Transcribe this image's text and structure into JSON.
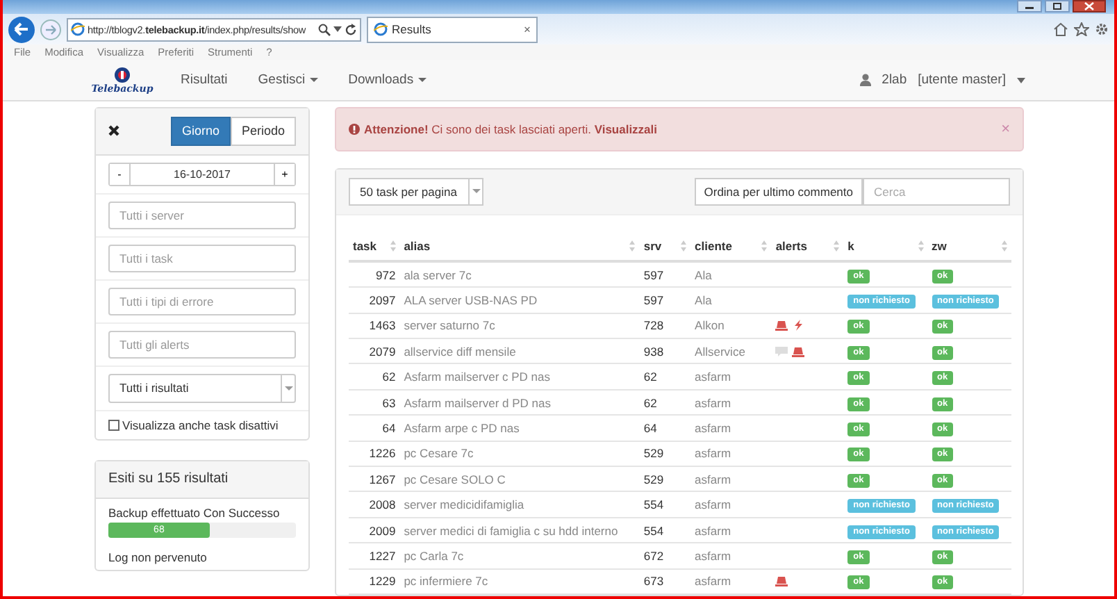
{
  "browser": {
    "address": "http://tblogv2.**telebackup.it**/index.php/results/show",
    "tab": {
      "title": "Results",
      "close": "×"
    },
    "menu": [
      "File",
      "Modifica",
      "Visualizza",
      "Preferiti",
      "Strumenti",
      "?"
    ]
  },
  "navbar": {
    "brand": "Telebackup",
    "links": [
      {
        "label": "Risultati",
        "dropdown": false
      },
      {
        "label": "Gestisci",
        "dropdown": true
      },
      {
        "label": "Downloads",
        "dropdown": true
      }
    ],
    "user": "2lab",
    "role": "[utente master]"
  },
  "filters": {
    "modes": [
      {
        "label": "Giorno",
        "selected": true
      },
      {
        "label": "Periodo",
        "selected": false
      }
    ],
    "date": {
      "minus": "-",
      "value": "16-10-2017",
      "plus": "+"
    },
    "fields": [
      {
        "placeholder": "Tutti i server"
      },
      {
        "placeholder": "Tutti i task"
      },
      {
        "placeholder": "Tutti i tipi di errore"
      },
      {
        "placeholder": "Tutti gli alerts"
      }
    ],
    "result_select": "Tutti i risultati",
    "show_disabled": {
      "label": "Visualizza anche task disattivi",
      "checked": false
    }
  },
  "summary": {
    "title": "Esiti su 155 risultati",
    "items": [
      {
        "label": "Backup effettuato Con Successo",
        "count": "68",
        "level": 0.54
      },
      {
        "label": "Log non pervenuto"
      }
    ]
  },
  "alert": {
    "text": "**Attenzione!** Ci sono dei task lasciati aperti. **Visualizzali**",
    "close": "×"
  },
  "toolbar": {
    "page_size": "50 task per pagina",
    "sort_button": "Ordina per ultimo commento",
    "search_placeholder": "Cerca"
  },
  "table": {
    "columns": [
      "task",
      "alias",
      "srv",
      "cliente",
      "alerts",
      "k",
      "zw"
    ],
    "rows": [
      {
        "task": "972",
        "alias": "ala server 7c",
        "srv": "597",
        "cliente": "Ala",
        "alerts": [],
        "k": {
          "label": "ok",
          "kind": "success"
        },
        "zw": {
          "label": "ok",
          "kind": "success"
        }
      },
      {
        "task": "2097",
        "alias": "ALA server USB-NAS PD",
        "srv": "597",
        "cliente": "Ala",
        "alerts": [],
        "k": {
          "label": "non richiesto",
          "kind": "info"
        },
        "zw": {
          "label": "non richiesto",
          "kind": "info"
        }
      },
      {
        "task": "1463",
        "alias": "server saturno 7c",
        "srv": "728",
        "cliente": "Alkon",
        "alerts": [
          {
            "kind": "siren"
          },
          {
            "kind": "bolt"
          }
        ],
        "k": {
          "label": "ok",
          "kind": "success"
        },
        "zw": {
          "label": "ok",
          "kind": "success"
        }
      },
      {
        "task": "2079",
        "alias": "allservice diff mensile",
        "srv": "938",
        "cliente": "Allservice",
        "alerts": [
          {
            "kind": "comment"
          },
          {
            "kind": "siren"
          }
        ],
        "k": {
          "label": "ok",
          "kind": "success"
        },
        "zw": {
          "label": "ok",
          "kind": "success"
        }
      },
      {
        "task": "62",
        "alias": "Asfarm mailserver c PD nas",
        "srv": "62",
        "cliente": "asfarm",
        "alerts": [],
        "k": {
          "label": "ok",
          "kind": "success"
        },
        "zw": {
          "label": "ok",
          "kind": "success"
        }
      },
      {
        "task": "63",
        "alias": "Asfarm mailserver d PD nas",
        "srv": "62",
        "cliente": "asfarm",
        "alerts": [],
        "k": {
          "label": "ok",
          "kind": "success"
        },
        "zw": {
          "label": "ok",
          "kind": "success"
        }
      },
      {
        "task": "64",
        "alias": "Asfarm arpe c PD nas",
        "srv": "64",
        "cliente": "asfarm",
        "alerts": [],
        "k": {
          "label": "ok",
          "kind": "success"
        },
        "zw": {
          "label": "ok",
          "kind": "success"
        }
      },
      {
        "task": "1226",
        "alias": "pc Cesare 7c",
        "srv": "529",
        "cliente": "asfarm",
        "alerts": [],
        "k": {
          "label": "ok",
          "kind": "success"
        },
        "zw": {
          "label": "ok",
          "kind": "success"
        }
      },
      {
        "task": "1267",
        "alias": "pc Cesare SOLO C",
        "srv": "529",
        "cliente": "asfarm",
        "alerts": [],
        "k": {
          "label": "ok",
          "kind": "success"
        },
        "zw": {
          "label": "ok",
          "kind": "success"
        }
      },
      {
        "task": "2008",
        "alias": "server medicidifamiglia",
        "srv": "554",
        "cliente": "asfarm",
        "alerts": [],
        "k": {
          "label": "non richiesto",
          "kind": "info"
        },
        "zw": {
          "label": "non richiesto",
          "kind": "info"
        }
      },
      {
        "task": "2009",
        "alias": "server medici di famiglia c su hdd interno",
        "srv": "554",
        "cliente": "asfarm",
        "alerts": [],
        "k": {
          "label": "non richiesto",
          "kind": "info"
        },
        "zw": {
          "label": "non richiesto",
          "kind": "info"
        }
      },
      {
        "task": "1227",
        "alias": "pc Carla 7c",
        "srv": "672",
        "cliente": "asfarm",
        "alerts": [],
        "k": {
          "label": "ok",
          "kind": "success"
        },
        "zw": {
          "label": "ok",
          "kind": "success"
        }
      },
      {
        "task": "1229",
        "alias": "pc infermiere 7c",
        "srv": "673",
        "cliente": "asfarm",
        "alerts": [
          {
            "kind": "siren"
          }
        ],
        "k": {
          "label": "ok",
          "kind": "success"
        },
        "zw": {
          "label": "ok",
          "kind": "success"
        }
      }
    ]
  }
}
